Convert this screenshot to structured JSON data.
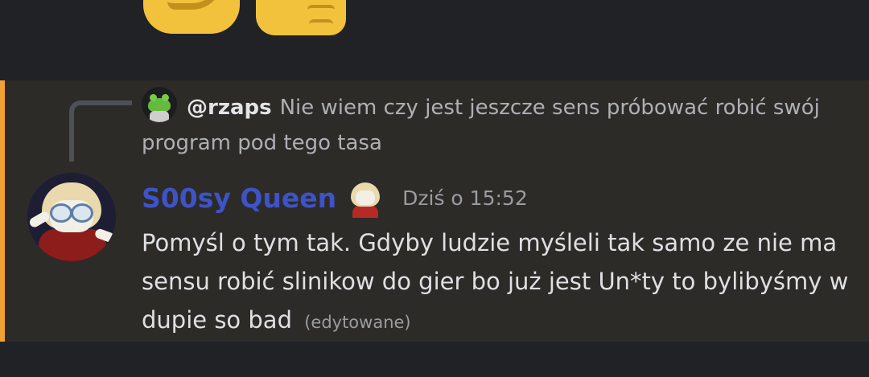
{
  "reply": {
    "author": "@rzaps",
    "text": "Nie wiem czy jest jeszcze sens próbować robić swój program pod tego tasa"
  },
  "message": {
    "author": "S00sy Queen",
    "timestamp": "Dziś o 15:52",
    "text": "Pomyśl o tym tak. Gdyby ludzie myśleli tak samo ze nie ma sensu robić slinikow do gier bo już jest Un*ty to bylibyśmy w dupie so bad",
    "edited": "(edytowane)"
  },
  "colors": {
    "background": "#202226",
    "highlight": "#2d2b28",
    "mention_bar": "#f0a232",
    "username": "#3d53c7"
  }
}
